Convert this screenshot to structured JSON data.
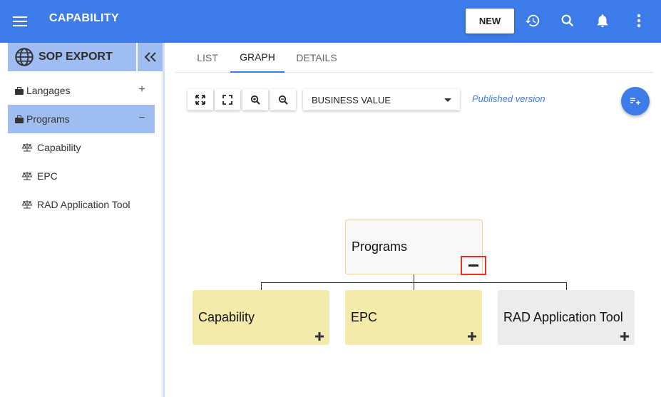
{
  "app_bar": {
    "menu_icon": "menu-icon",
    "title": "CAPABILITY",
    "new_label": "NEW",
    "icons": [
      "history-icon",
      "search-icon",
      "bell-icon",
      "more-vert-icon"
    ],
    "color": "#3d7be8"
  },
  "sidebar": {
    "header": {
      "icon": "globe-icon",
      "label": "SOP EXPORT"
    },
    "collapse_icon": "double-chevron-left-icon",
    "items": [
      {
        "label": "Langages",
        "icon": "briefcase-icon",
        "action": "+"
      },
      {
        "label": "Programs",
        "icon": "briefcase-icon",
        "action": "−",
        "selected": true
      }
    ],
    "children": [
      {
        "label": "Capability",
        "icon": "scale-icon"
      },
      {
        "label": "EPC",
        "icon": "scale-icon"
      },
      {
        "label": "RAD Application Tool",
        "icon": "scale-icon"
      }
    ]
  },
  "tabs": [
    {
      "label": "LIST"
    },
    {
      "label": "GRAPH",
      "active": true
    },
    {
      "label": "DETAILS"
    }
  ],
  "toolbar": {
    "buttons": [
      "fit-to-screen-icon",
      "fullscreen-icon",
      "zoom-in-icon",
      "zoom-out-icon"
    ],
    "select_value": "BUSINESS VALUE",
    "published_label": "Published version",
    "fab_icon": "add-list-icon"
  },
  "graph": {
    "root": {
      "label": "Programs",
      "toggle": "−"
    },
    "children": [
      {
        "label": "Capability",
        "color": "#f3eaab",
        "toggle": "+"
      },
      {
        "label": "EPC",
        "color": "#f3eaab",
        "toggle": "+"
      },
      {
        "label": "RAD Application Tool",
        "color": "#ececec",
        "toggle": "+"
      }
    ]
  }
}
